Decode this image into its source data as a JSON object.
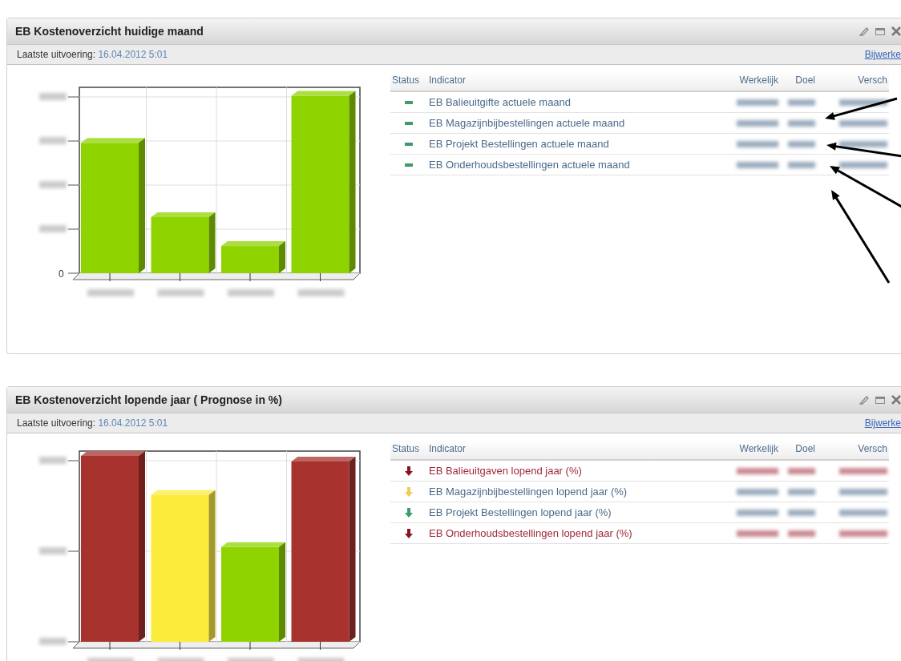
{
  "panels": [
    {
      "title": "EB Kostenoverzicht huidige maand",
      "last_run_label": "Laatste uitvoering:",
      "last_run_value": "16.04.2012 5:01",
      "refresh_link": "Bijwerke",
      "chart": {
        "zero_tick": "0"
      },
      "columns": [
        "Status",
        "Indicator",
        "Werkelijk",
        "Doel",
        "Versch"
      ],
      "rows": [
        {
          "kind": "dash",
          "color": "#3f9b6a",
          "indicator": "EB Balieuitgifte actuele maand"
        },
        {
          "kind": "dash",
          "color": "#3f9b6a",
          "indicator": "EB Magazijnbijbestellingen actuele maand"
        },
        {
          "kind": "dash",
          "color": "#3f9b6a",
          "indicator": "EB Projekt Bestellingen actuele maand"
        },
        {
          "kind": "dash",
          "color": "#3f9b6a",
          "indicator": "EB Onderhoudsbestellingen actuele maand"
        }
      ],
      "annotated": true
    },
    {
      "title": "EB Kostenoverzicht lopende jaar ( Prognose in %)",
      "last_run_label": "Laatste uitvoering:",
      "last_run_value": "16.04.2012 5:01",
      "refresh_link": "Bijwerke",
      "columns": [
        "Status",
        "Indicator",
        "Werkelijk",
        "Doel",
        "Versch"
      ],
      "rows": [
        {
          "kind": "arrow",
          "color": "#8a1420",
          "indicator": "EB Balieuitgaven lopend jaar (%)"
        },
        {
          "kind": "arrow",
          "color": "#f0cc50",
          "indicator": "EB Magazijnbijbestellingen lopend jaar (%)"
        },
        {
          "kind": "arrow",
          "color": "#3f9b6a",
          "indicator": "EB Projekt Bestellingen lopend jaar (%)"
        },
        {
          "kind": "arrow",
          "color": "#8a1420",
          "indicator": "EB Onderhoudsbestellingen lopend jaar (%)"
        }
      ],
      "annotated": false
    }
  ]
}
